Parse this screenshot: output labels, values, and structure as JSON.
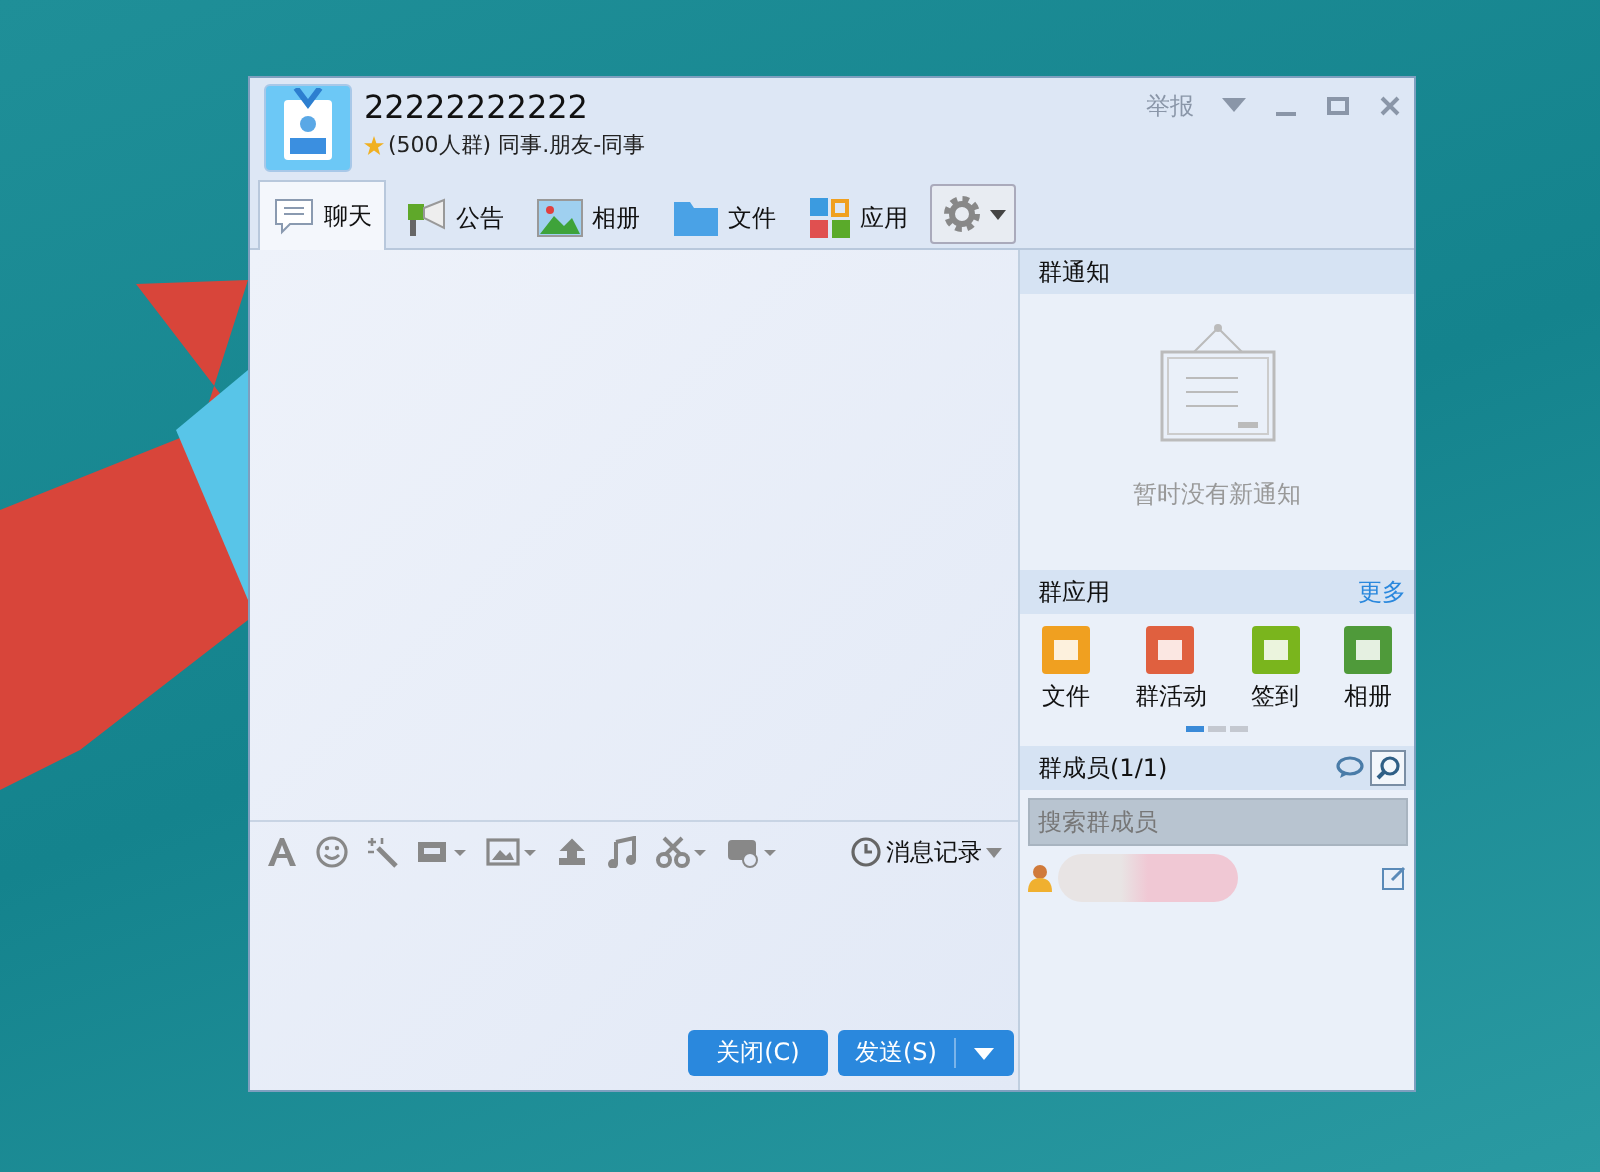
{
  "window": {
    "title": "22222222222",
    "subtitle": "(500人群) 同事.朋友-同事",
    "report": "举报"
  },
  "tabs": [
    {
      "label": "聊天",
      "selected": true
    },
    {
      "label": "公告",
      "selected": false
    },
    {
      "label": "相册",
      "selected": false
    },
    {
      "label": "文件",
      "selected": false
    },
    {
      "label": "应用",
      "selected": false
    }
  ],
  "toolbar": {
    "history": "消息记录"
  },
  "buttons": {
    "close": "关闭(C)",
    "send": "发送(S)"
  },
  "notice": {
    "title": "群通知",
    "empty": "暂时没有新通知"
  },
  "apps": {
    "title": "群应用",
    "more": "更多",
    "items": [
      {
        "label": "文件",
        "color": "#f0a020"
      },
      {
        "label": "群活动",
        "color": "#e0603f"
      },
      {
        "label": "签到",
        "color": "#7ab51d"
      },
      {
        "label": "相册",
        "color": "#4f9a3a"
      }
    ],
    "pages": [
      {
        "selected": true
      },
      {
        "selected": false
      },
      {
        "selected": false
      }
    ]
  },
  "members": {
    "title": "群成员(1/1)",
    "placeholder": "搜索群成员"
  }
}
